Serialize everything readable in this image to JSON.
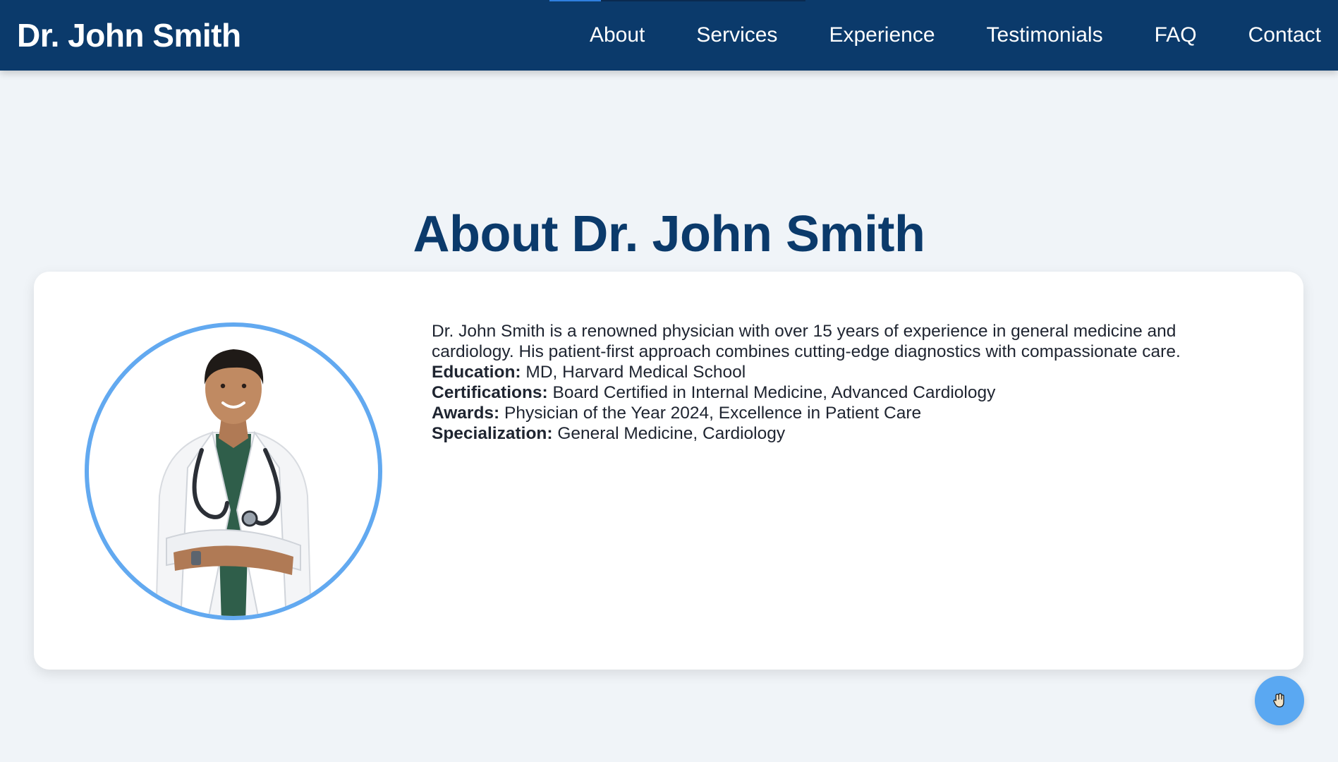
{
  "site": {
    "brand": "Dr. John Smith"
  },
  "nav": {
    "items": [
      {
        "label": "About"
      },
      {
        "label": "Services"
      },
      {
        "label": "Experience"
      },
      {
        "label": "Testimonials"
      },
      {
        "label": "FAQ"
      },
      {
        "label": "Contact"
      }
    ],
    "scroll_progress": 0.2
  },
  "about": {
    "title": "About Dr. John Smith",
    "intro": "Dr. John Smith is a renowned physician with over 15 years of experience in general medicine and cardiology. His patient-first approach combines cutting-edge diagnostics with compassionate care.",
    "details": [
      {
        "label": "Education:",
        "value": "MD, Harvard Medical School"
      },
      {
        "label": "Certifications:",
        "value": "Board Certified in Internal Medicine, Advanced Cardiology"
      },
      {
        "label": "Awards:",
        "value": "Physician of the Year 2024, Excellence in Patient Care"
      },
      {
        "label": "Specialization:",
        "value": "General Medicine, Cardiology"
      }
    ]
  },
  "fab": {
    "icon": "hand-icon"
  },
  "colors": {
    "navbar": "#0b3a6b",
    "title": "#0b3a6b",
    "accent": "#62a9f0",
    "fab": "#5aa8f2",
    "background": "#f0f4f8"
  }
}
